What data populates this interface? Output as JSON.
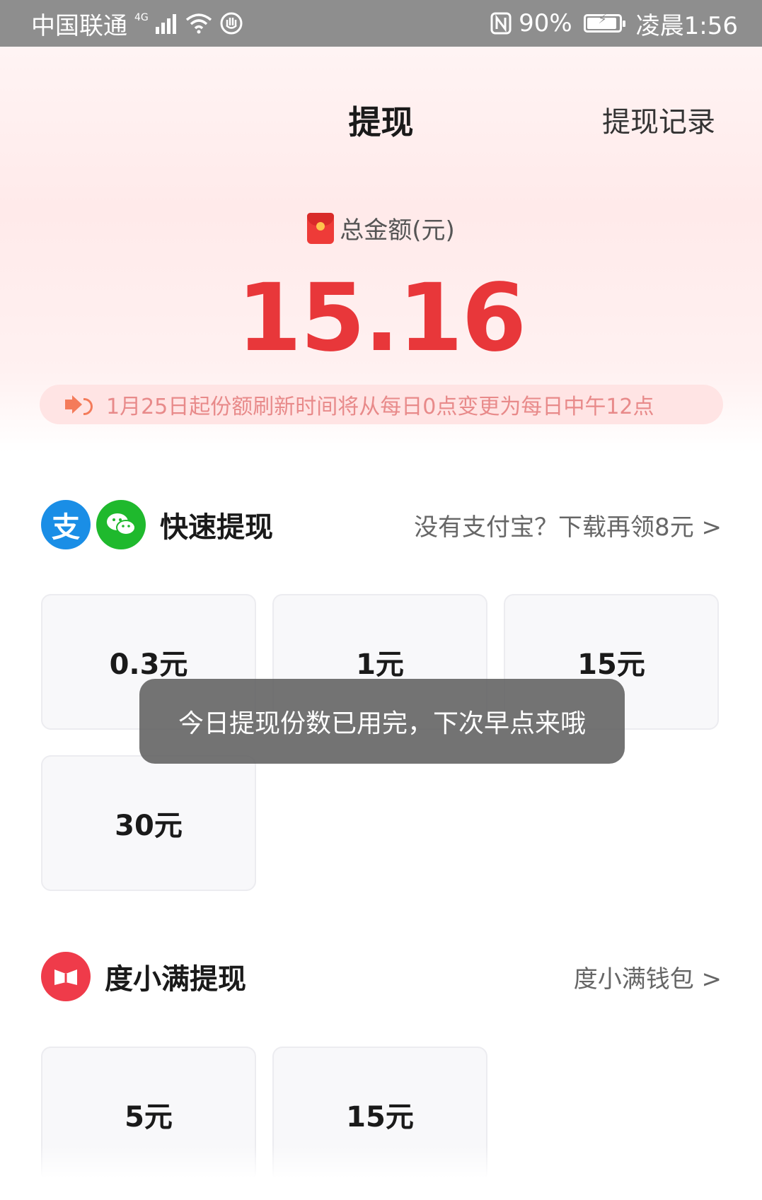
{
  "status_bar": {
    "carrier": "中国联通",
    "network": "4G",
    "battery": "90%",
    "time": "凌晨1:56"
  },
  "header": {
    "title": "提现",
    "records_link": "提现记录"
  },
  "balance": {
    "label": "总金额(元)",
    "amount": "15.16"
  },
  "notice": {
    "text": "1月25日起份额刷新时间将从每日0点变更为每日中午12点"
  },
  "quick_withdraw": {
    "title": "快速提现",
    "link": "没有支付宝？下载再领8元 >",
    "alipay_logo": "支",
    "options": [
      "0.3元",
      "1元",
      "15元",
      "30元"
    ]
  },
  "duxiaoman_withdraw": {
    "title": "度小满提现",
    "link": "度小满钱包 >",
    "options": [
      "5元",
      "15元"
    ]
  },
  "toast": {
    "message": "今日提现份数已用完，下次早点来哦"
  },
  "colors": {
    "accent_red": "#e8373a",
    "alipay_blue": "#1a8ee6",
    "wechat_green": "#1fb92d",
    "duxiaoman_red": "#ef3b4a"
  }
}
